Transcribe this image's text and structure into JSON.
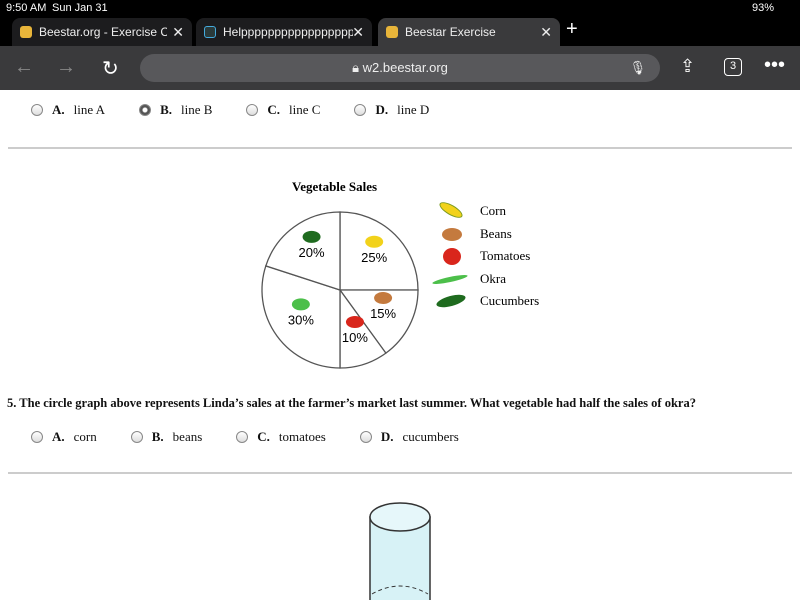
{
  "status": {
    "time": "9:50 AM",
    "date": "Sun Jan 31",
    "battery": "93%"
  },
  "tabs": [
    {
      "label": "Beestar.org - Exercise Co",
      "icon": "bee-icon"
    },
    {
      "label": "Helppppppppppppppppp",
      "icon": "brainly-icon"
    },
    {
      "label": "Beestar Exercise",
      "icon": "bee-icon",
      "active": true
    }
  ],
  "toolbar": {
    "url": "w2.beestar.org",
    "tab_count": "3"
  },
  "prev_question": {
    "options": [
      {
        "letter": "A.",
        "text": "line A",
        "selected": false
      },
      {
        "letter": "B.",
        "text": "line B",
        "selected": true
      },
      {
        "letter": "C.",
        "text": "line C",
        "selected": false
      },
      {
        "letter": "D.",
        "text": "line D",
        "selected": false
      }
    ]
  },
  "chart_data": {
    "type": "pie",
    "title": "Vegetable Sales",
    "categories": [
      "Corn",
      "Beans",
      "Tomatoes",
      "Okra",
      "Cucumbers"
    ],
    "values": [
      25,
      15,
      10,
      30,
      20
    ],
    "labels": [
      "25%",
      "15%",
      "10%",
      "30%",
      "20%"
    ],
    "colors": {
      "Corn": "#f2d21b",
      "Beans": "#c47a3e",
      "Tomatoes": "#d9261c",
      "Okra": "#4cbf4a",
      "Cucumbers": "#1f6b1f"
    },
    "legend_position": "right"
  },
  "question": {
    "text": "5. The circle graph above represents Linda’s sales at the farmer’s market last summer. What vegetable had half the sales of okra?",
    "options": [
      {
        "letter": "A.",
        "text": "corn"
      },
      {
        "letter": "B.",
        "text": "beans"
      },
      {
        "letter": "C.",
        "text": "tomatoes"
      },
      {
        "letter": "D.",
        "text": "cucumbers"
      }
    ]
  }
}
